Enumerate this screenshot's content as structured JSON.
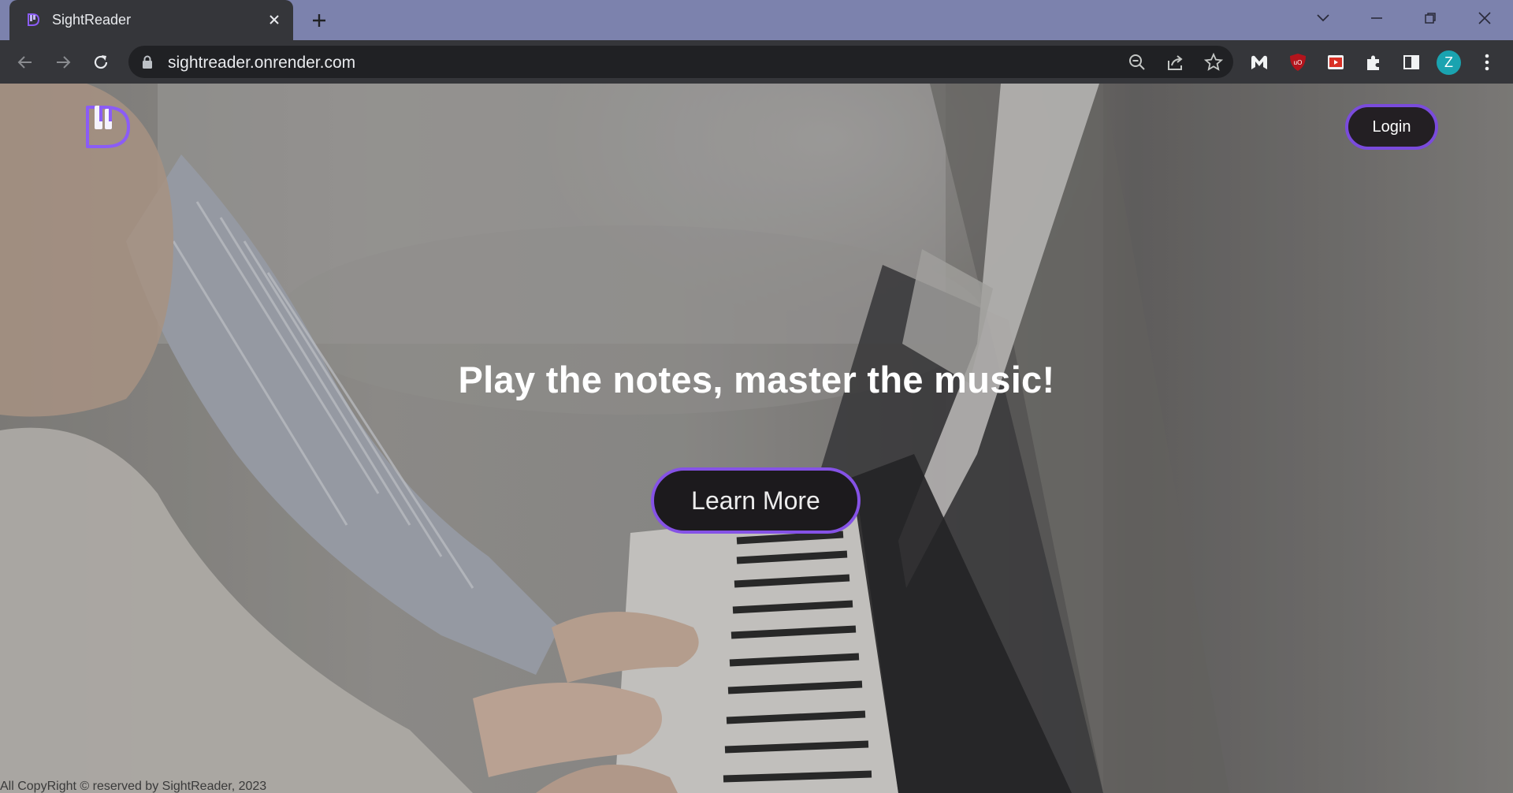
{
  "browser": {
    "tab_title": "SightReader",
    "url": "sightreader.onrender.com",
    "profile_initial": "Z"
  },
  "icons": {
    "favicon": "sightreader-logo-icon",
    "tab_close": "close-icon",
    "new_tab": "plus-icon",
    "back": "arrow-left-icon",
    "forward": "arrow-right-icon",
    "reload": "reload-icon",
    "lock": "lock-icon",
    "zoom": "zoom-out-icon",
    "share": "share-icon",
    "bookmark": "star-icon",
    "extensions": [
      "malwarebytes-icon",
      "ublock-icon",
      "screen-recorder-icon",
      "puzzle-icon",
      "side-panel-icon"
    ],
    "menu": "kebab-menu-icon"
  },
  "header": {
    "login_label": "Login"
  },
  "hero": {
    "title": "Play the notes, master the music!",
    "cta_label": "Learn More"
  },
  "footer": {
    "copyright": "All CopyRight © reserved by SightReader, 2023"
  },
  "colors": {
    "accent": "#8552e6",
    "button_bg": "#1c1a1d",
    "tabbar_bg": "#7c82ad",
    "chrome_bg": "#35363a"
  }
}
